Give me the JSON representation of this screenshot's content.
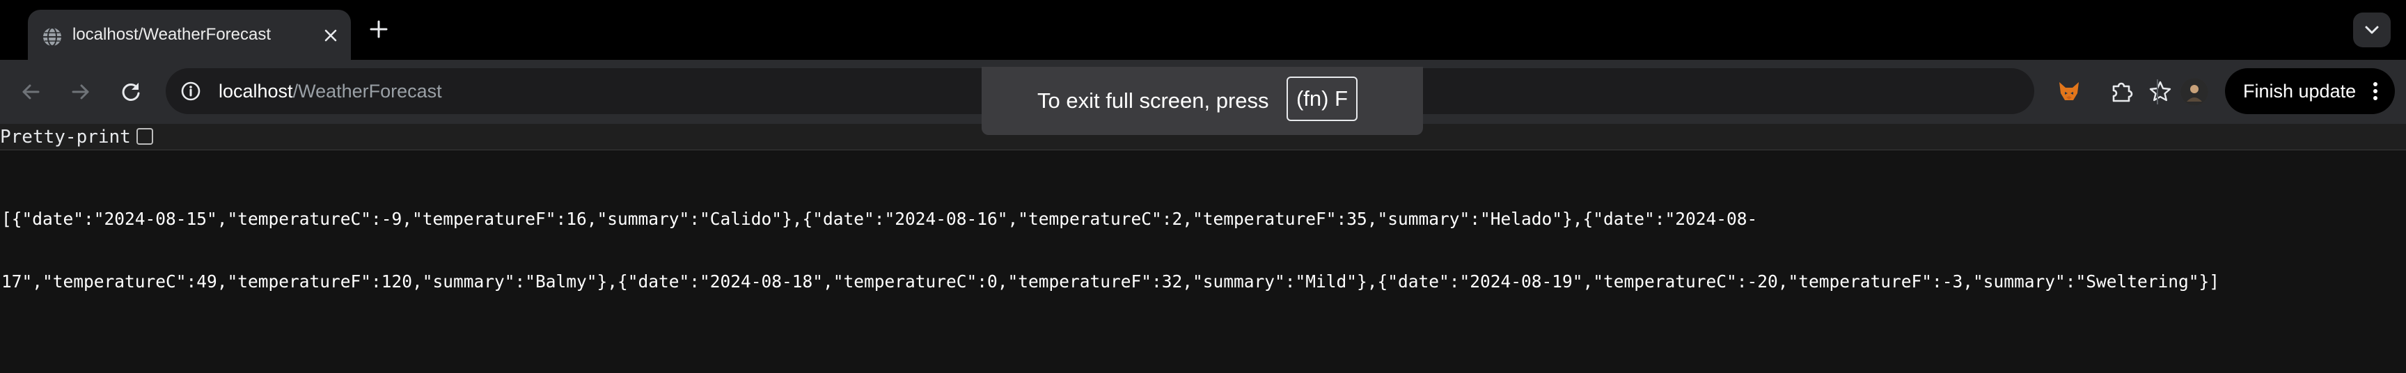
{
  "tab": {
    "title": "localhost/WeatherForecast",
    "favicon": "globe-icon",
    "close_icon": "close-icon",
    "new_tab_icon": "plus-icon"
  },
  "toolbar": {
    "back_icon": "arrow-left-icon",
    "forward_icon": "arrow-right-icon",
    "reload_icon": "reload-icon",
    "site_info_icon": "info-icon",
    "url_host": "localhost",
    "url_path": "/WeatherForecast",
    "bookmark_icon": "star-icon",
    "extensions": [
      "fox-extension-icon",
      "puzzle-extension-icon"
    ],
    "finish_update_label": "Finish update",
    "menu_icon": "kebab-menu-icon"
  },
  "fullscreen_toast": {
    "text": "To exit full screen, press",
    "key": "(fn) F"
  },
  "viewer": {
    "pretty_print_label": "Pretty-print",
    "pretty_print_checked": false,
    "json_line_1": "[{\"date\":\"2024-08-15\",\"temperatureC\":-9,\"temperatureF\":16,\"summary\":\"Calido\"},{\"date\":\"2024-08-16\",\"temperatureC\":2,\"temperatureF\":35,\"summary\":\"Helado\"},{\"date\":\"2024-08-",
    "json_line_2": "17\",\"temperatureC\":49,\"temperatureF\":120,\"summary\":\"Balmy\"},{\"date\":\"2024-08-18\",\"temperatureC\":0,\"temperatureF\":32,\"summary\":\"Mild\"},{\"date\":\"2024-08-19\",\"temperatureC\":-20,\"temperatureF\":-3,\"summary\":\"Sweltering\"}]"
  },
  "colors": {
    "tab_strip_bg": "#000000",
    "toolbar_bg": "#2b2c2f",
    "omnibox_bg": "#1c1c1e",
    "page_bg": "#131313",
    "toast_bg": "#3c3c3f"
  }
}
